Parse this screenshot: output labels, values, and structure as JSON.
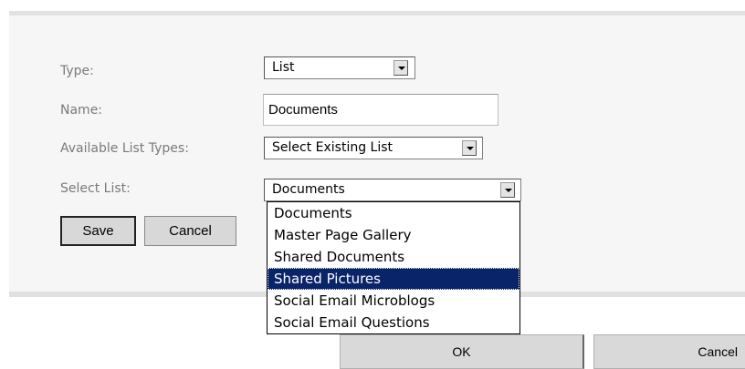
{
  "form": {
    "type_label": "Type:",
    "type_value": "List",
    "name_label": "Name:",
    "name_value": "Documents",
    "available_list_types_label": "Available List Types:",
    "available_list_types_value": "Select Existing List",
    "select_list_label": "Select List:",
    "select_list_value": "Documents",
    "save_label": "Save",
    "cancel_label": "Cancel"
  },
  "dropdown": {
    "selected_index": 3,
    "options": [
      "Documents",
      "Master Page Gallery",
      "Shared Documents",
      "Shared Pictures",
      "Social Email Microblogs",
      "Social Email Questions"
    ]
  },
  "footer": {
    "ok_label": "OK",
    "cancel_label": "Cancel"
  },
  "icons": {
    "dropdown_arrow": "chevron-down-icon"
  }
}
